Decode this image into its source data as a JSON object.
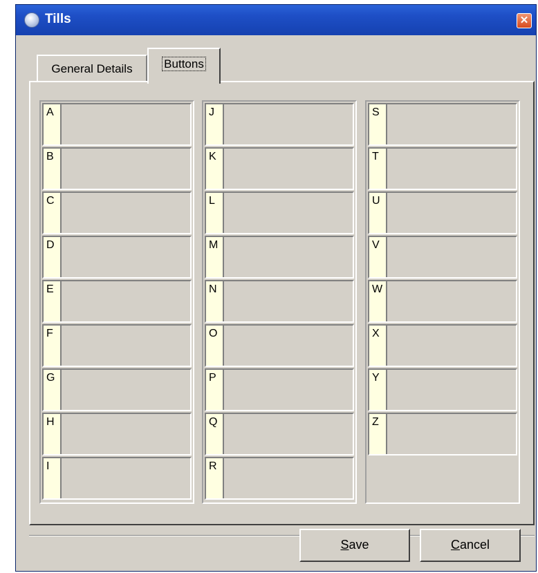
{
  "window": {
    "title": "Tills",
    "close_glyph": "✕"
  },
  "tabs": [
    {
      "label": "General Details",
      "active": false
    },
    {
      "label": "Buttons",
      "active": true
    }
  ],
  "button_slots": {
    "columns": [
      [
        "A",
        "B",
        "C",
        "D",
        "E",
        "F",
        "G",
        "H",
        "I"
      ],
      [
        "J",
        "K",
        "L",
        "M",
        "N",
        "O",
        "P",
        "Q",
        "R"
      ],
      [
        "S",
        "T",
        "U",
        "V",
        "W",
        "X",
        "Y",
        "Z"
      ]
    ],
    "slot_fill": "#ffffe1"
  },
  "actions": {
    "save": {
      "mnemonic": "S",
      "rest": "ave"
    },
    "cancel": {
      "mnemonic": "C",
      "rest": "ancel"
    }
  },
  "colors": {
    "titlebar": "#1e4fc6",
    "dialog_bg": "#d4d0c8"
  }
}
